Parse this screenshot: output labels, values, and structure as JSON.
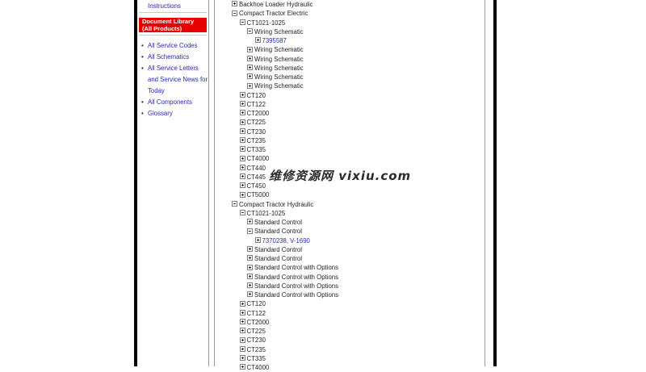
{
  "sidebar": {
    "top_link": "Instructions",
    "doc_library": [
      "Document Library",
      "(All Products)"
    ],
    "links": [
      "All Service Codes",
      "All Schematics",
      "All Service Letters",
      "and Service News for",
      "Today",
      "All Components",
      "Glossary"
    ]
  },
  "tree": [
    {
      "label": "Backhoe Loader Hydraulic",
      "level": 0,
      "state": "plus",
      "link": false
    },
    {
      "label": "Compact Tractor Electric",
      "level": 0,
      "state": "minus",
      "link": false
    },
    {
      "label": "CT1021-1025",
      "level": 1,
      "state": "minus",
      "link": false
    },
    {
      "label": "Wiring Schematic",
      "level": 2,
      "state": "minus",
      "link": false
    },
    {
      "label": "7395587",
      "level": 3,
      "state": "plus",
      "link": true
    },
    {
      "label": "Wiring Schematic",
      "level": 2,
      "state": "plus",
      "link": false
    },
    {
      "label": "Wiring Schematic",
      "level": 2,
      "state": "plus",
      "link": false
    },
    {
      "label": "Wiring Schematic",
      "level": 2,
      "state": "plus",
      "link": false
    },
    {
      "label": "Wiring Schematic",
      "level": 2,
      "state": "plus",
      "link": false
    },
    {
      "label": "Wiring Schematic",
      "level": 2,
      "state": "plus",
      "link": false
    },
    {
      "label": "CT120",
      "level": 1,
      "state": "plus",
      "link": false
    },
    {
      "label": "CT122",
      "level": 1,
      "state": "plus",
      "link": false
    },
    {
      "label": "CT2000",
      "level": 1,
      "state": "plus",
      "link": false
    },
    {
      "label": "CT225",
      "level": 1,
      "state": "plus",
      "link": false
    },
    {
      "label": "CT230",
      "level": 1,
      "state": "plus",
      "link": false
    },
    {
      "label": "CT235",
      "level": 1,
      "state": "plus",
      "link": false
    },
    {
      "label": "CT335",
      "level": 1,
      "state": "plus",
      "link": false
    },
    {
      "label": "CT4000",
      "level": 1,
      "state": "plus",
      "link": false
    },
    {
      "label": "CT440",
      "level": 1,
      "state": "plus",
      "link": false
    },
    {
      "label": "CT445",
      "level": 1,
      "state": "plus",
      "link": false
    },
    {
      "label": "CT450",
      "level": 1,
      "state": "plus",
      "link": false
    },
    {
      "label": "CT5000",
      "level": 1,
      "state": "plus",
      "link": false
    },
    {
      "label": "Compact Tractor Hydraulic",
      "level": 0,
      "state": "minus",
      "link": false
    },
    {
      "label": "CT1021-1025",
      "level": 1,
      "state": "minus",
      "link": false
    },
    {
      "label": "Standard Control",
      "level": 2,
      "state": "plus",
      "link": false
    },
    {
      "label": "Standard Control",
      "level": 2,
      "state": "minus",
      "link": false
    },
    {
      "label": "7370238, V-1690",
      "level": 3,
      "state": "plus",
      "link": true
    },
    {
      "label": "Standard Control",
      "level": 2,
      "state": "plus",
      "link": false
    },
    {
      "label": "Standard Control",
      "level": 2,
      "state": "plus",
      "link": false
    },
    {
      "label": "Standard Control with Options",
      "level": 2,
      "state": "plus",
      "link": false
    },
    {
      "label": "Standard Control with Options",
      "level": 2,
      "state": "plus",
      "link": false
    },
    {
      "label": "Standard Control with Options",
      "level": 2,
      "state": "plus",
      "link": false
    },
    {
      "label": "Standard Control with Options",
      "level": 2,
      "state": "plus",
      "link": false
    },
    {
      "label": "CT120",
      "level": 1,
      "state": "plus",
      "link": false
    },
    {
      "label": "CT122",
      "level": 1,
      "state": "plus",
      "link": false
    },
    {
      "label": "CT2000",
      "level": 1,
      "state": "plus",
      "link": false
    },
    {
      "label": "CT225",
      "level": 1,
      "state": "plus",
      "link": false
    },
    {
      "label": "CT230",
      "level": 1,
      "state": "plus",
      "link": false
    },
    {
      "label": "CT235",
      "level": 1,
      "state": "plus",
      "link": false
    },
    {
      "label": "CT335",
      "level": 1,
      "state": "plus",
      "link": false
    },
    {
      "label": "CT4000",
      "level": 1,
      "state": "plus",
      "link": false
    }
  ],
  "watermark": "维修资源网 vixiu.com",
  "colors": {
    "link": "#2a2aa8",
    "doc_library_bg": "#e60000",
    "text": "#222222"
  }
}
